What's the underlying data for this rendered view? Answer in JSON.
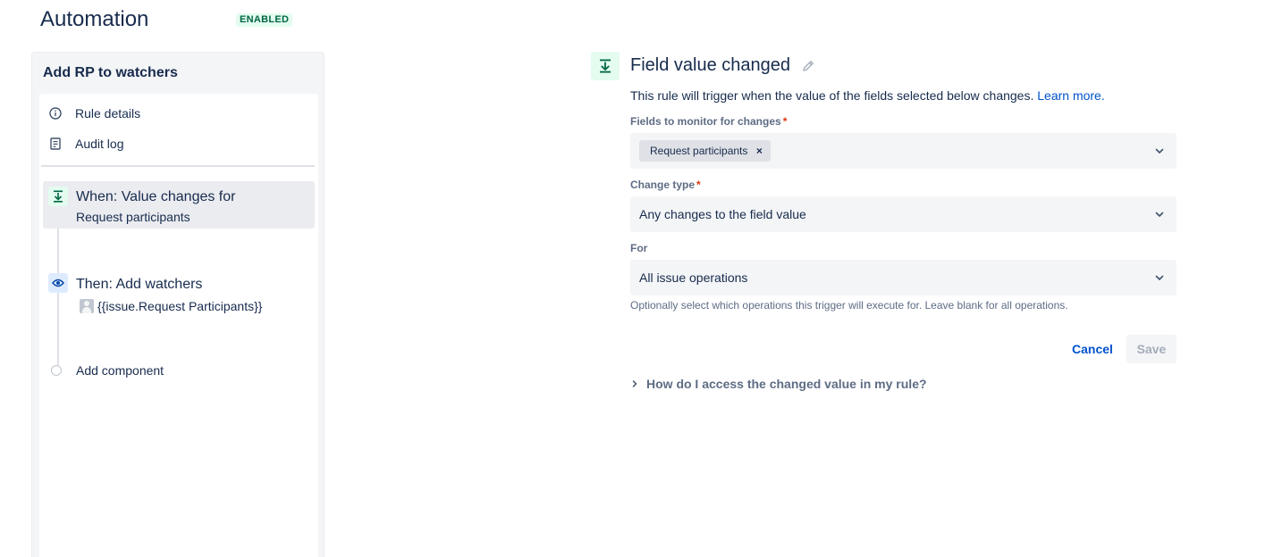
{
  "header": {
    "title": "Automation",
    "status_badge": "ENABLED"
  },
  "sidebar": {
    "rule_name": "Add RP to watchers",
    "menu": [
      {
        "label": "Rule details",
        "icon": "info-icon"
      },
      {
        "label": "Audit log",
        "icon": "document-icon"
      }
    ],
    "steps": [
      {
        "title": "When: Value changes for",
        "subtitle": "Request participants",
        "icon": "trigger-icon"
      },
      {
        "title": "Then: Add watchers",
        "subtitle": "{{issue.Request Participants}}",
        "icon": "eye-icon"
      }
    ],
    "add_component_label": "Add component"
  },
  "panel": {
    "title": "Field value changed",
    "description": "This rule will trigger when the value of the fields selected below changes.",
    "learn_more": "Learn more.",
    "fields_label": "Fields to monitor for changes",
    "fields_tag": "Request participants",
    "change_type_label": "Change type",
    "change_type_value": "Any changes to the field value",
    "for_label": "For",
    "for_value": "All issue operations",
    "help_text": "Optionally select which operations this trigger will execute for. Leave blank for all operations.",
    "cancel_label": "Cancel",
    "save_label": "Save",
    "faq_label": "How do I access the changed value in my rule?"
  },
  "colors": {
    "link": "#0052cc",
    "success_bg": "#e3fcef",
    "success_text": "#006644",
    "required": "#de350b"
  }
}
